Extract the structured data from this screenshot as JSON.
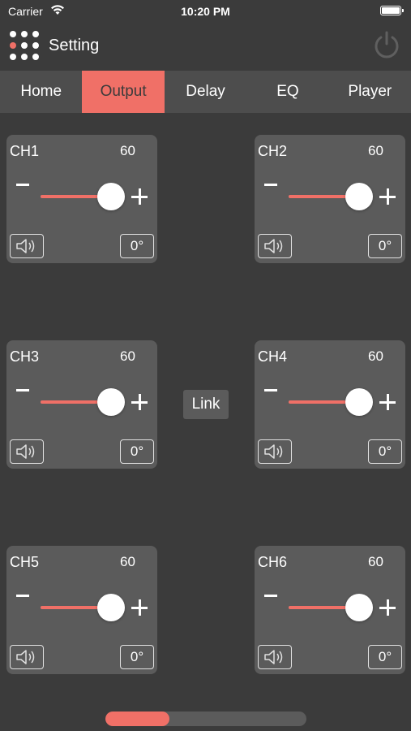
{
  "status_bar": {
    "carrier": "Carrier",
    "time": "10:20 PM"
  },
  "header": {
    "title": "Setting"
  },
  "tabs": [
    {
      "label": "Home",
      "active": false
    },
    {
      "label": "Output",
      "active": true
    },
    {
      "label": "Delay",
      "active": false
    },
    {
      "label": "EQ",
      "active": false
    },
    {
      "label": "Player",
      "active": false
    }
  ],
  "channels": [
    {
      "name": "CH1",
      "value": "60",
      "level": 0.85,
      "phase": "0°"
    },
    {
      "name": "CH2",
      "value": "60",
      "level": 0.85,
      "phase": "0°"
    },
    {
      "name": "CH3",
      "value": "60",
      "level": 0.85,
      "phase": "0°"
    },
    {
      "name": "CH4",
      "value": "60",
      "level": 0.85,
      "phase": "0°"
    },
    {
      "name": "CH5",
      "value": "60",
      "level": 0.85,
      "phase": "0°"
    },
    {
      "name": "CH6",
      "value": "60",
      "level": 0.85,
      "phase": "0°"
    }
  ],
  "link_label": "Link",
  "page_indicator": {
    "progress": 0.32
  },
  "colors": {
    "accent": "#f07067",
    "background": "#3b3b3b",
    "card": "#5b5b5b",
    "tab_bar": "#4d4d4d"
  },
  "icons": {
    "menu": "dot-grid-icon",
    "power": "power-icon",
    "speaker": "speaker-icon",
    "wifi": "wifi-icon",
    "battery": "battery-icon"
  }
}
